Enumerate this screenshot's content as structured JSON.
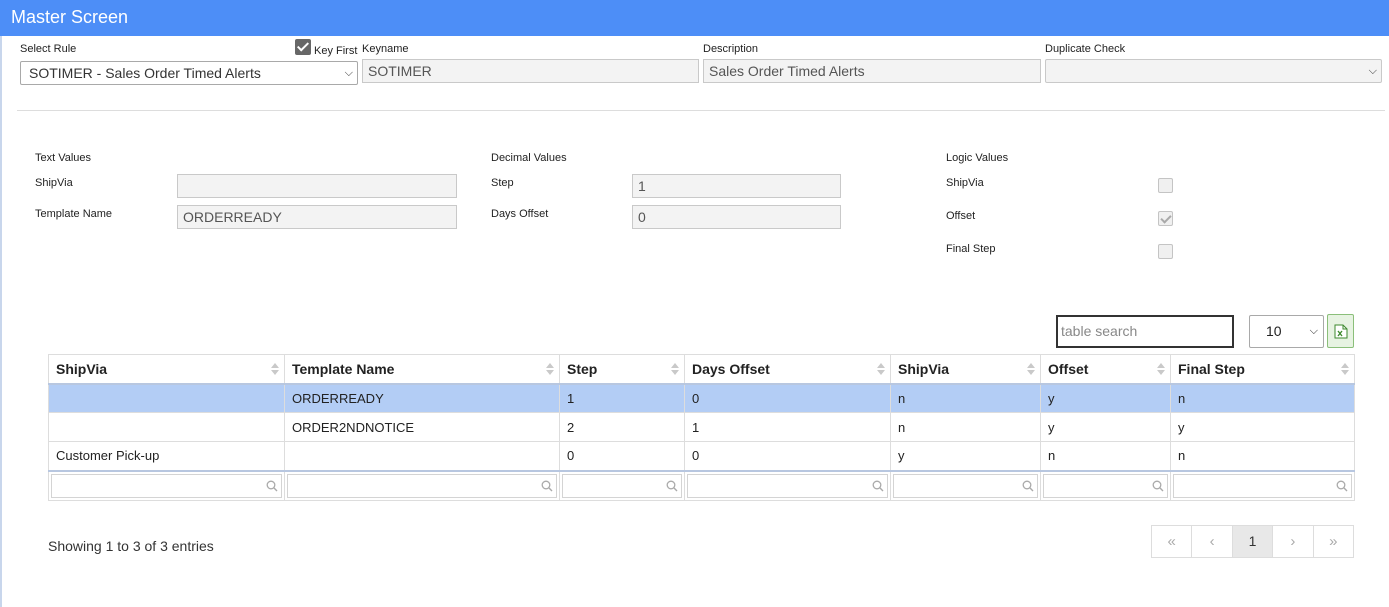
{
  "header": {
    "title": "Master Screen"
  },
  "top": {
    "select_rule_label": "Select Rule",
    "select_rule_value": "SOTIMER - Sales Order Timed Alerts",
    "key_first_label": "Key First",
    "key_first_checked": true,
    "keyname_label": "Keyname",
    "keyname_value": "SOTIMER",
    "description_label": "Description",
    "description_value": "Sales Order Timed Alerts",
    "duplicate_check_label": "Duplicate Check",
    "duplicate_check_value": ""
  },
  "text_values": {
    "heading": "Text Values",
    "shipvia_label": "ShipVia",
    "shipvia_value": "",
    "template_label": "Template Name",
    "template_value": "ORDERREADY"
  },
  "decimal_values": {
    "heading": "Decimal Values",
    "step_label": "Step",
    "step_value": "1",
    "days_offset_label": "Days Offset",
    "days_offset_value": "0"
  },
  "logic_values": {
    "heading": "Logic Values",
    "shipvia_label": "ShipVia",
    "shipvia_checked": false,
    "offset_label": "Offset",
    "offset_checked": true,
    "final_step_label": "Final Step",
    "final_step_checked": false
  },
  "table_controls": {
    "search_placeholder": "table search",
    "page_size": "10",
    "excel_icon": "excel-export-icon"
  },
  "table": {
    "columns": [
      "ShipVia",
      "Template Name",
      "Step",
      "Days Offset",
      "ShipVia",
      "Offset",
      "Final Step"
    ],
    "rows": [
      [
        "",
        "ORDERREADY",
        "1",
        "0",
        "n",
        "y",
        "n"
      ],
      [
        "",
        "ORDER2NDNOTICE",
        "2",
        "1",
        "n",
        "y",
        "y"
      ],
      [
        "Customer Pick-up",
        "",
        "0",
        "0",
        "y",
        "n",
        "n"
      ]
    ],
    "selected_row": 0
  },
  "footer": {
    "info": "Showing 1 to 3 of 3 entries",
    "pager": {
      "first": "«",
      "prev": "‹",
      "current": "1",
      "next": "›",
      "last": "»"
    }
  },
  "colors": {
    "header": "#4d8ef7",
    "selected_row": "#b3cdf5"
  }
}
